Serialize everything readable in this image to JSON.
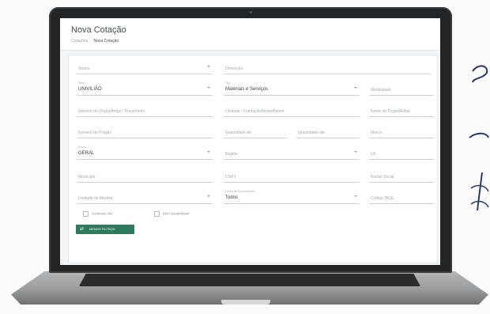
{
  "app": {
    "title": "Nova Cotação",
    "breadcrumb": [
      "Cotações",
      "Nova Cotação"
    ]
  },
  "form": {
    "fields": {
      "status": {
        "label": "Status",
        "value": ""
      },
      "descricao": {
        "label": "Descrição",
        "value": ""
      },
      "setor": {
        "label": "Setor",
        "value": "UNIVILIÃO"
      },
      "tipo": {
        "label": "Tipo",
        "value": "Materiais e Serviços"
      },
      "modalidade": {
        "label": "Modalidade",
        "value": ""
      },
      "numero_orgao": {
        "label": "Número do Órgão/Artigo / Documento",
        "value": ""
      },
      "unidade_orgao": {
        "label": "Unidade / Fundação/Nome/Nome",
        "value": ""
      },
      "nome_orgao": {
        "label": "Nome do Órgão/Edital",
        "value": ""
      },
      "numero_pregao": {
        "label": "Número do Pregão",
        "value": ""
      },
      "quantidade_de": {
        "label": "Quantidade de",
        "value": ""
      },
      "quantidade_ate": {
        "label": "Quantidade até",
        "value": ""
      },
      "marca": {
        "label": "Marca",
        "value": ""
      },
      "grupo": {
        "label": "Grupo",
        "value": "GERAL"
      },
      "regiao": {
        "label": "Região",
        "value": ""
      },
      "uf": {
        "label": "UF",
        "value": ""
      },
      "municipio": {
        "label": "Município",
        "value": ""
      },
      "cnpj": {
        "label": "CNPJ",
        "value": ""
      },
      "razao_social": {
        "label": "Razão Social",
        "value": ""
      },
      "unidade_medida": {
        "label": "Unidade de Medida",
        "value": ""
      },
      "forma_fornecimento": {
        "label": "Forma de Fornecimento",
        "value": "Todos"
      },
      "codigo_ibge": {
        "label": "Código IBGE",
        "value": ""
      }
    },
    "checkboxes": [
      "Somente Ativ",
      "Item Sustentável"
    ],
    "filter_button_label": "MENOS FILTROS"
  },
  "colors": {
    "accent": "#2d7a5e",
    "bezel": "#232426"
  }
}
